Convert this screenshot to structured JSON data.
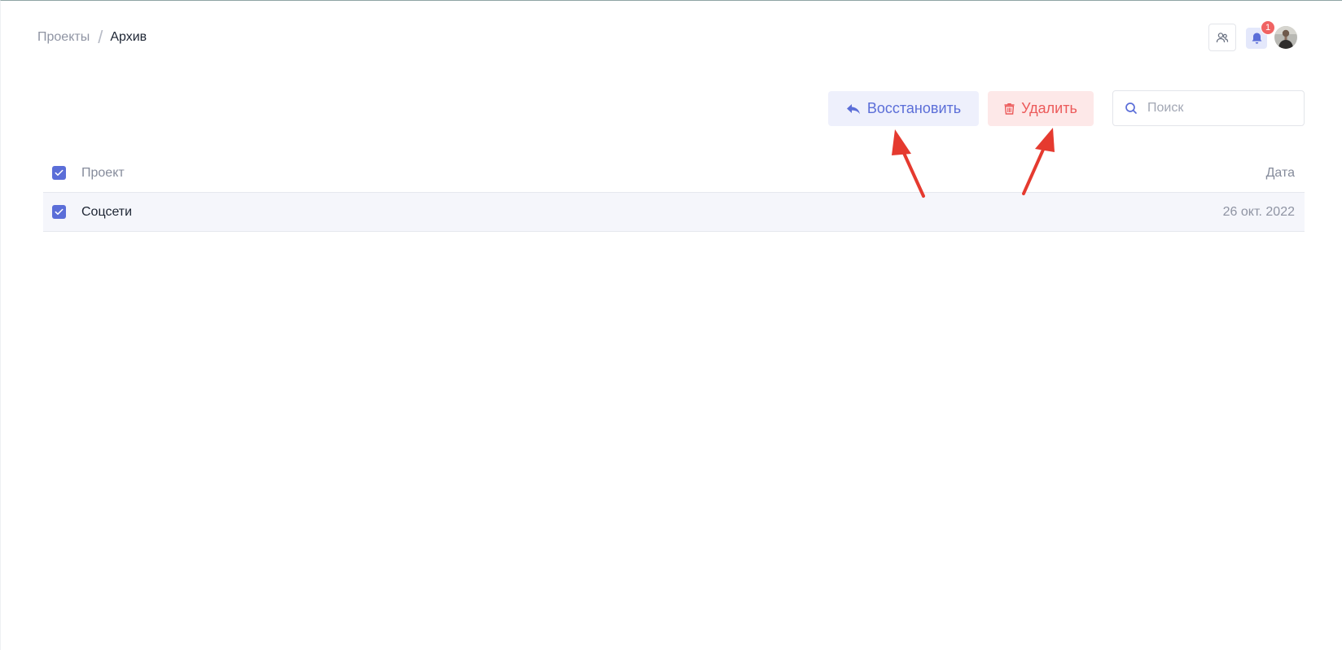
{
  "breadcrumb": {
    "parent": "Проекты",
    "separator": "/",
    "current": "Архив"
  },
  "header": {
    "users_icon": "users-icon",
    "bell_icon": "bell-icon",
    "notification_count": "1"
  },
  "toolbar": {
    "restore_label": "Восстановить",
    "delete_label": "Удалить",
    "search_placeholder": "Поиск"
  },
  "table": {
    "columns": {
      "name": "Проект",
      "date": "Дата"
    },
    "rows": [
      {
        "name": "Соцсети",
        "date": "26 окт. 2022",
        "checked": true
      }
    ],
    "select_all_checked": true
  },
  "colors": {
    "accent": "#5b6ed8",
    "danger": "#ec5a5a",
    "annotation_arrow": "#e53a2f"
  }
}
